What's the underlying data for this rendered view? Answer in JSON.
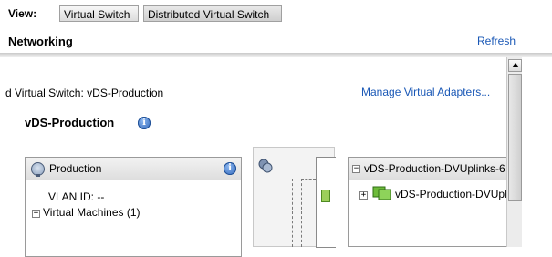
{
  "view": {
    "label": "View:",
    "buttons": [
      "Virtual Switch",
      "Distributed Virtual Switch"
    ],
    "selected": "Distributed Virtual Switch"
  },
  "networking": {
    "title": "Networking",
    "refresh": "Refresh"
  },
  "switch": {
    "header": "d Virtual Switch: vDS-Production",
    "manage_link": "Manage Virtual Adapters...",
    "section_title": "vDS-Production"
  },
  "port_group": {
    "title": "Production",
    "vlan": "VLAN ID: --",
    "expander": "+",
    "vm_label": "Virtual Machines (1)"
  },
  "uplinks": {
    "collapse": "−",
    "title": "vDS-Production-DVUplinks-6",
    "expander": "+",
    "item": "vDS-Production-DVUpl"
  },
  "colors": {
    "link": "#1a58b6",
    "panel_header": "#e6e6e6",
    "port_green": "#9ccf5a"
  },
  "icons": {
    "info": "i",
    "port_group": "network-globe-icon",
    "switch": "switch-icon",
    "uplink": "uplink-nic-icon"
  }
}
